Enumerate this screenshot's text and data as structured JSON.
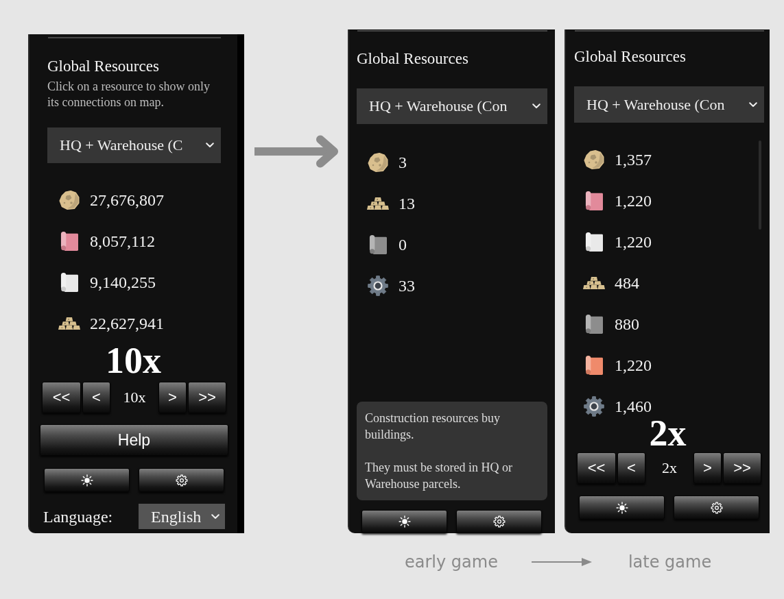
{
  "panels": [
    {
      "title": "Global Resources",
      "subtitle": "Click on a resource to show only its connections on map.",
      "filter": "HQ + Warehouse (C",
      "resources": [
        {
          "kind": "stone",
          "color": "#d9bf8e",
          "amount": "27,676,807"
        },
        {
          "kind": "scroll",
          "color": "#e28a9b",
          "amount": "8,057,112"
        },
        {
          "kind": "scroll",
          "color": "#e9e9e9",
          "amount": "9,140,255"
        },
        {
          "kind": "bars",
          "color": "#d7c08f",
          "amount": "22,627,941"
        }
      ],
      "speed": {
        "current": "10x",
        "slower_buttons": [
          "<<",
          "<"
        ],
        "readout": "10x",
        "faster_buttons": [
          ">",
          ">>"
        ]
      },
      "help_button": "Help",
      "tool_buttons": [
        {
          "kind": "brightness"
        },
        {
          "kind": "settings"
        }
      ],
      "language": {
        "label": "Language:",
        "value": "English"
      }
    },
    {
      "title": "Global Resources",
      "filter": "HQ + Warehouse (Con",
      "resources": [
        {
          "kind": "stone",
          "color": "#d9bf8e",
          "amount": "3"
        },
        {
          "kind": "bars",
          "color": "#d7c08f",
          "amount": "13"
        },
        {
          "kind": "scroll",
          "color": "#8d8d8d",
          "amount": "0"
        },
        {
          "kind": "gear",
          "color": "#6f7b88",
          "amount": "33"
        }
      ],
      "note": [
        "Construction resources buy buildings.",
        "They must be stored in HQ or Warehouse parcels."
      ],
      "tool_buttons": [
        {
          "kind": "brightness"
        },
        {
          "kind": "settings"
        }
      ]
    },
    {
      "title": "Global Resources",
      "filter": "HQ + Warehouse (Con",
      "scrollable": true,
      "resources": [
        {
          "kind": "stone",
          "color": "#d9bf8e",
          "amount": "1,357"
        },
        {
          "kind": "scroll",
          "color": "#e28a9b",
          "amount": "1,220"
        },
        {
          "kind": "scroll",
          "color": "#e9e9e9",
          "amount": "1,220"
        },
        {
          "kind": "bars",
          "color": "#d7c08f",
          "amount": "484"
        },
        {
          "kind": "scroll",
          "color": "#8d8d8d",
          "amount": "880"
        },
        {
          "kind": "scroll",
          "color": "#ef8a6b",
          "amount": "1,220"
        },
        {
          "kind": "gear",
          "color": "#6f7b88",
          "amount": "1,460"
        }
      ],
      "speed": {
        "current": "2x",
        "slower_buttons": [
          "<<",
          "<"
        ],
        "readout": "2x",
        "faster_buttons": [
          ">",
          ">>"
        ]
      },
      "tool_buttons": [
        {
          "kind": "brightness"
        },
        {
          "kind": "settings"
        }
      ]
    }
  ],
  "captions": {
    "from": "early game",
    "to": "late game"
  }
}
